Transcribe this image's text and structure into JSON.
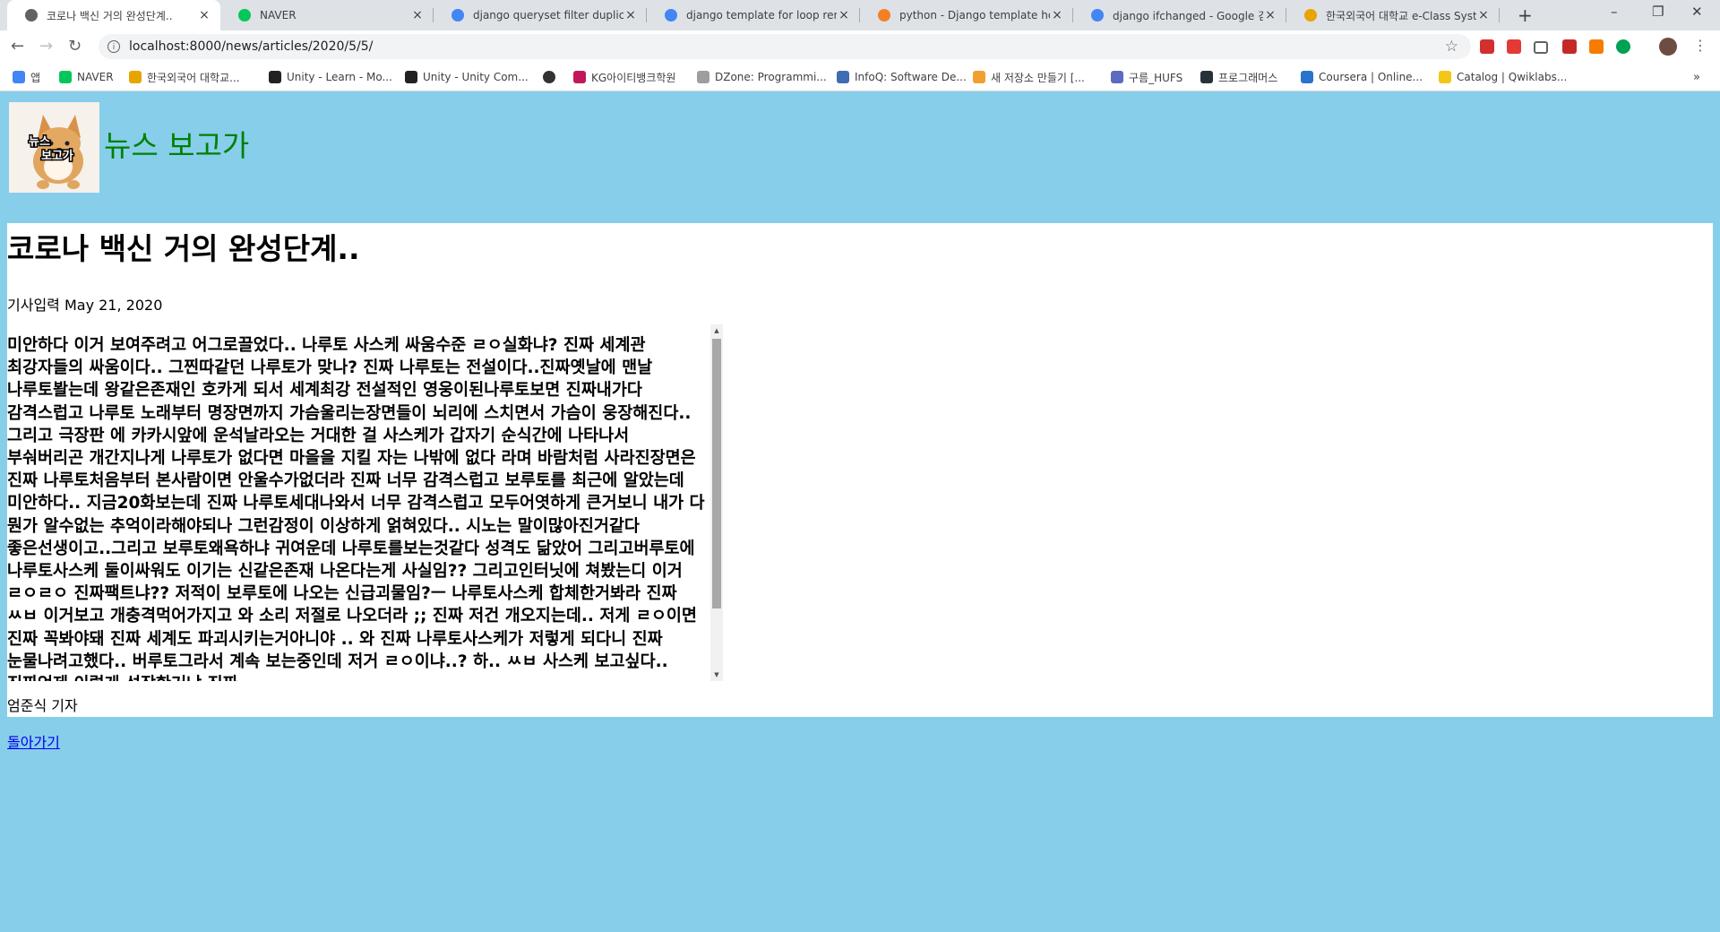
{
  "tabs": [
    {
      "title": "코로나 백신 거의 완성단계..",
      "active": true,
      "favicon": "chrome-icon",
      "color": "#5f6368"
    },
    {
      "title": "NAVER",
      "active": false,
      "favicon": "naver-icon",
      "color": "#03c75a"
    },
    {
      "title": "django queryset filter duplicates",
      "active": false,
      "favicon": "google-icon",
      "color": "#4285f4"
    },
    {
      "title": "django template for loop remove",
      "active": false,
      "favicon": "google-icon",
      "color": "#4285f4"
    },
    {
      "title": "python - Django template how",
      "active": false,
      "favicon": "stackoverflow-icon",
      "color": "#f48024"
    },
    {
      "title": "django ifchanged - Google 검색",
      "active": false,
      "favicon": "google-icon",
      "color": "#4285f4"
    },
    {
      "title": "한국외국어 대학교 e-Class System",
      "active": false,
      "favicon": "hufs-icon",
      "color": "#e6a500"
    }
  ],
  "toolbar": {
    "url": "localhost:8000/news/articles/2020/5/5/"
  },
  "bookmarks": [
    {
      "label": "앱",
      "icon": "apps-grid-icon",
      "color": "#4285f4"
    },
    {
      "label": "NAVER",
      "icon": "naver-icon",
      "color": "#03c75a"
    },
    {
      "label": "한국외국어 대학교...",
      "icon": "hufs-icon",
      "color": "#e6a500"
    },
    {
      "label": "Unity - Learn - Mo...",
      "icon": "unity-icon",
      "color": "#222222"
    },
    {
      "label": "Unity - Unity Com...",
      "icon": "unity-icon",
      "color": "#222222"
    },
    {
      "label": "",
      "icon": "globe-icon",
      "color": "#333333"
    },
    {
      "label": "KG아이티뱅크학원",
      "icon": "kg-icon",
      "color": "#c2185b"
    },
    {
      "label": "DZone: Programmi...",
      "icon": "dzone-icon",
      "color": "#9e9e9e"
    },
    {
      "label": "InfoQ: Software De...",
      "icon": "infoq-icon",
      "color": "#3f6db3"
    },
    {
      "label": "새 저장소 만들기 [...",
      "icon": "github-octocat-icon",
      "color": "#f0a030"
    },
    {
      "label": "구름_HUFS",
      "icon": "goorm-icon",
      "color": "#5c6bc0"
    },
    {
      "label": "프로그래머스",
      "icon": "programmers-icon",
      "color": "#263238"
    },
    {
      "label": "Coursera | Online...",
      "icon": "coursera-icon",
      "color": "#2a73cc"
    },
    {
      "label": "Catalog | Qwiklabs...",
      "icon": "qwiklabs-icon",
      "color": "#f5c518"
    }
  ],
  "site": {
    "title": "뉴스 보고가",
    "logo_text": "뉴스보고가"
  },
  "article": {
    "title": "코로나 백신 거의 완성단계..",
    "date": "기사입력 May 21, 2020",
    "body": "미안하다 이거 보여주려고 어그로끌었다.. 나루토 사스케 싸움수준 ㄹㅇ실화냐? 진짜 세계관 최강자들의 싸움이다.. 그찐따같던 나루토가 맞나? 진짜 나루토는 전설이다..진짜옛날에 맨날 나루토봘는데 왕같은존재인 호카게 되서 세계최강 전설적인 영웅이된나루토보면 진짜내가다 감격스럽고 나루토 노래부터 명장면까지 가슴울리는장면들이 뇌리에 스치면서 가슴이 웅장해진다.. 그리고 극장판 에 카카시앞에 운석날라오는 거대한 걸 사스케가 갑자기 순식간에 나타나서 부숴버리곤 개간지나게 나루토가 없다면 마을을 지킬 자는 나밖에 없다 라며 바람처럼 사라진장면은 진짜 나루토처음부터 본사람이면 안울수가없더라 진짜 너무 감격스럽고 보루토를 최근에 알았는데 미안하다.. 지금20화보는데 진짜 나루토세대나와서 너무 감격스럽고 모두어엿하게 큰거보니 내가 다 뭔가 알수없는 추억이라해야되나 그런감정이 이상하게 얽혀있다.. 시노는 말이많아진거같다 좋은선생이고..그리고 보루토왜욕하냐 귀여운데 나루토를보는것같다 성격도 닮았어 그리고버루토에 나루토사스케 둘이싸워도 이기는 신같은존재 나온다는게 사실임?? 그리고인터닛에 쳐봤는디 이거 ㄹㅇㄹㅇ 진짜팩트냐?? 저적이 보루토에 나오는 신급괴물임?ㅡ 나루토사스케 합체한거봐라 진짜 ㅆㅂ 이거보고 개충격먹어가지고 와 소리 저절로 나오더라 ;; 진짜 저건 개오지는데.. 저게 ㄹㅇ이면 진짜 꼭봐야돼 진짜 세계도 파괴시키는거아니야 .. 와 진짜 나루토사스케가 저렇게 되다니 진짜 눈물나려고했다.. 버루토그라서 계속 보는중인데 저거 ㄹㅇ이냐..? 하.. ㅆㅂ 사스케 보고싶다.. 진짜언제 이렇게 성장한거냐 진짜",
    "reporter": "엄준식 기자",
    "back_link": "돌아가기"
  }
}
